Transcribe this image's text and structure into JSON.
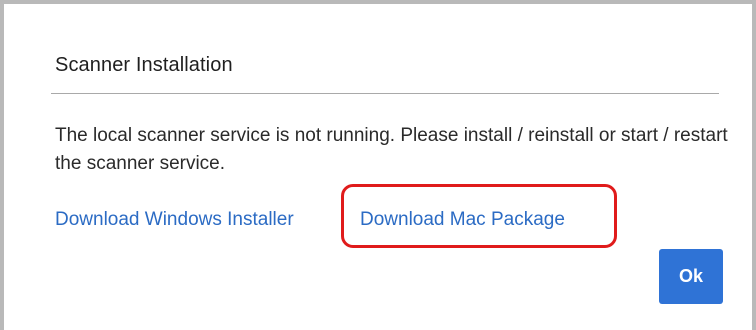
{
  "dialog": {
    "title": "Scanner Installation",
    "message": "The local scanner service is not running. Please install / reinstall or start / restart the scanner service.",
    "links": {
      "windows": "Download Windows Installer",
      "mac": "Download Mac Package"
    },
    "ok_label": "Ok"
  },
  "colors": {
    "link": "#2b6bc4",
    "ok_button": "#2f73d6",
    "highlight": "#e01b1b"
  }
}
